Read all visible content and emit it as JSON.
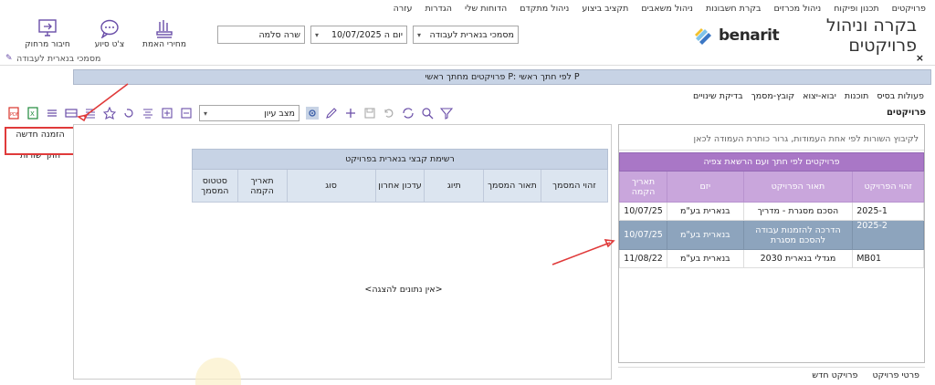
{
  "topmenu": [
    "פרויקטים",
    "תכנון ופיקוח",
    "ניהול מכרזים",
    "בקרת חשבונות",
    "ניהול משאבים",
    "תקציב ביצוע",
    "ניהול מתקדם",
    "הדוחות שלי",
    "הגדרות",
    "עזרה"
  ],
  "logo": {
    "brand": "benarit",
    "app_title": "בקרה וניהול פרויקטים"
  },
  "filters": {
    "docs": "מסמכי בנארית לעבודה",
    "date": "יום ה 10/07/2025",
    "user": "שרה סלמה"
  },
  "tools": [
    {
      "label": "מחירי האמת",
      "icon": "price-icon"
    },
    {
      "label": "צ'ט סיוע",
      "icon": "chat-icon"
    },
    {
      "label": "חיבור מרחוק",
      "icon": "remote-icon"
    }
  ],
  "window": {
    "title": "מסמכי בנארית לעבודה",
    "close": "×"
  },
  "main_header": "פרויקטים מחתך ראשי P: לפי חתך ראשי P",
  "right_tabs": [
    "פעולות בסיס",
    "תוכנות",
    "יבוא-יצוא",
    "קובץ-מסמך",
    "בדיקת שינויים"
  ],
  "section_title": "פרויקטים",
  "toolbar": {
    "view_mode": "מצב עיון"
  },
  "left_pane": {
    "new_order": "הזמנה חדשה",
    "row_cut": "חתך שורות"
  },
  "files_grid": {
    "title": "רשימת קבצי בנארית בפרויקט",
    "columns": [
      "זהוי המסמך",
      "תאור המסמך",
      "תיוג",
      "עדכון אחרון",
      "סוג",
      "תאריך הקמה",
      "סטטוס המסמך"
    ],
    "empty_text": "<אין נתונים להצגה>"
  },
  "projects_grid": {
    "group_hint": "לקיבוץ השורות לפי אחת העמודות, גרור כותרת העמודה לכאן",
    "title": "פרויקטים לפי חתך ועם הרשאת צפיה",
    "columns": [
      "זהוי הפרויקט",
      "תאור הפרויקט",
      "יזם",
      "תאריך הקמה"
    ],
    "rows": [
      {
        "id": "2025-1",
        "desc": "הסכם מסגרת - מדריך",
        "owner": "בנארית בע\"מ",
        "date": "10/07/25",
        "selected": false
      },
      {
        "id": "2025-2",
        "desc": "הדרכה להזמנות עבודה להסכם מסגרת",
        "owner": "בנארית בע\"מ",
        "date": "10/07/25",
        "selected": true
      },
      {
        "id": "MB01",
        "desc": "מגדלי בנארית 2030",
        "owner": "בנארית בע\"מ",
        "date": "11/08/22",
        "selected": false
      }
    ]
  },
  "bottom_tabs": [
    "פרטי פרויקט",
    "פרויקט חדש"
  ],
  "colors": {
    "accent": "#a977c6",
    "selected_row": "#8da4bd",
    "header_blue": "#c7d3e5",
    "callout": "#e03a3a"
  }
}
